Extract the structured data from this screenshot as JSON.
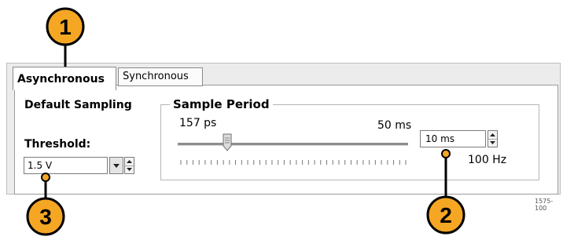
{
  "tabs": {
    "active": "Asynchronous",
    "inactive": "Synchronous"
  },
  "left": {
    "heading": "Default Sampling",
    "threshold_label": "Threshold:",
    "threshold_value": "1.5 V"
  },
  "sample_period": {
    "title": "Sample Period",
    "min_label": "157 ps",
    "max_label": "50 ms",
    "value": "10 ms",
    "rate": "100 Hz"
  },
  "callouts": [
    "1",
    "2",
    "3"
  ],
  "figure_id": "1575-100",
  "colors": {
    "callout_fill": "#f5a623",
    "callout_line": "#000000",
    "panel_bg": "#ececec"
  }
}
